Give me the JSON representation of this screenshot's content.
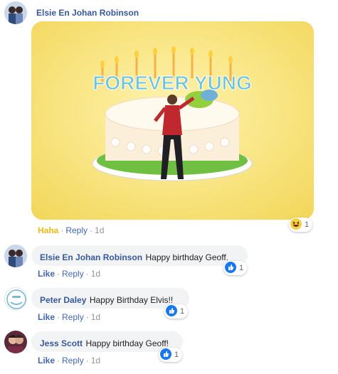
{
  "post": {
    "author": "Elsie En Johan Robinson",
    "media": {
      "overlay_text": "FOREVER YUNG"
    },
    "actions": {
      "reaction": "Haha",
      "reply": "Reply",
      "time": "1d"
    },
    "reaction": {
      "icon": "haha-emoji-icon",
      "count": "1"
    }
  },
  "comments": [
    {
      "author": "Elsie En Johan Robinson",
      "text": "Happy birthday Geoff.",
      "actions": {
        "like": "Like",
        "reply": "Reply",
        "time": "1d"
      },
      "reaction": {
        "icon": "like-thumb-icon",
        "count": "1"
      }
    },
    {
      "author": "Peter Daley",
      "text": "Happy Birthday Elvis!!",
      "actions": {
        "like": "Like",
        "reply": "Reply",
        "time": "1d"
      },
      "reaction": {
        "icon": "like-thumb-icon",
        "count": "1"
      }
    },
    {
      "author": "Jess Scott",
      "text": "Happy birthday Geoff!",
      "actions": {
        "like": "Like",
        "reply": "Reply",
        "time": "1d"
      },
      "reaction": {
        "icon": "like-thumb-icon",
        "count": "1"
      }
    }
  ],
  "colors": {
    "link": "#385898",
    "action": "#4267b2",
    "haha": "#f0ba15",
    "bubble": "#f2f3f5",
    "muted": "#90949c"
  }
}
